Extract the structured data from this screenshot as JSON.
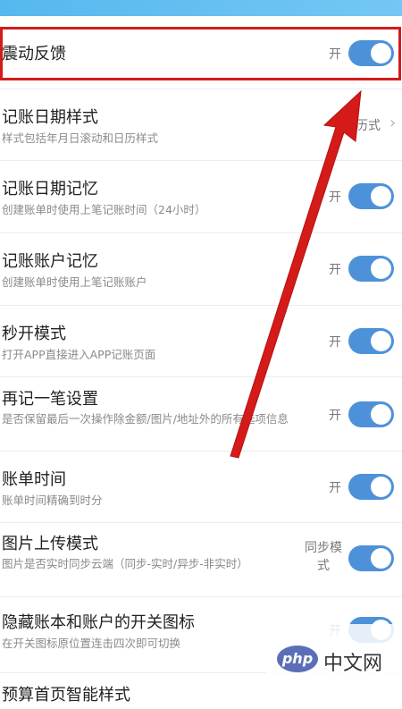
{
  "settings": [
    {
      "title": "震动反馈",
      "subtitle": "",
      "state": "开"
    },
    {
      "title": "记账日期样式",
      "subtitle": "样式包括年月日滚动和日历样式",
      "state": "历式"
    },
    {
      "title": "记账日期记忆",
      "subtitle": "创建账单时使用上笔记账时间（24小时）",
      "state": "开"
    },
    {
      "title": "记账账户记忆",
      "subtitle": "创建账单时使用上笔记账账户",
      "state": "开"
    },
    {
      "title": "秒开模式",
      "subtitle": "打开APP直接进入APP记账页面",
      "state": "开"
    },
    {
      "title": "再记一笔设置",
      "subtitle": "是否保留最后一次操作除金额/图片/地址外的所有选项信息",
      "state": "开"
    },
    {
      "title": "账单时间",
      "subtitle": "账单时间精确到时分",
      "state": "开"
    },
    {
      "title": "图片上传模式",
      "subtitle": "图片是否实时同步云端（同步-实时/异步-非实时）",
      "state": "同步模式"
    },
    {
      "title": "隐藏账本和账户的开关图标",
      "subtitle": "在开关图标原位置连击四次即可切换",
      "state": "开"
    },
    {
      "title": "预算首页智能样式",
      "subtitle": "",
      "state": ""
    }
  ],
  "watermark": {
    "logo": "php",
    "text": "中文网"
  },
  "colors": {
    "toggle_on": "#4d92d9",
    "highlight": "#d51a1a",
    "arrow": "#d51a1a",
    "topbar": "#5ab9ef"
  }
}
